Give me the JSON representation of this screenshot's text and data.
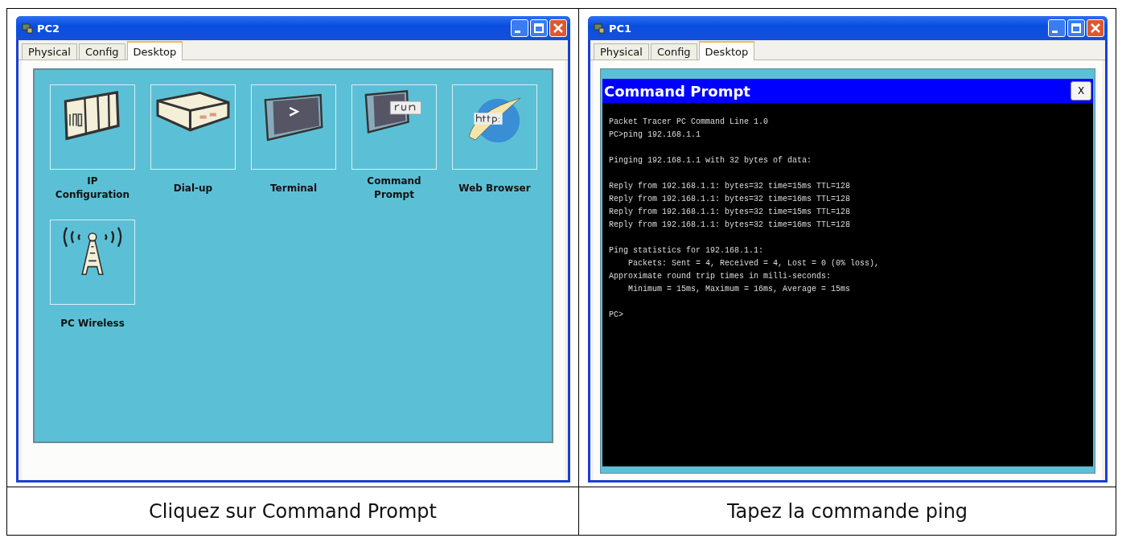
{
  "cells": [
    {
      "window": {
        "title": "PC2",
        "tabs": [
          {
            "label": "Physical",
            "selected": false
          },
          {
            "label": "Config",
            "selected": false
          },
          {
            "label": "Desktop",
            "selected": true
          }
        ],
        "view": {
          "kind": "desktop",
          "apps": [
            {
              "label": "IP Configuration"
            },
            {
              "label": "Dial-up"
            },
            {
              "label": "Terminal"
            },
            {
              "label": "Command Prompt"
            },
            {
              "label": "Web Browser"
            },
            {
              "label": "PC Wireless"
            }
          ]
        }
      },
      "caption": "Cliquez sur Command Prompt"
    },
    {
      "window": {
        "title": "PC1",
        "tabs": [
          {
            "label": "Physical",
            "selected": false
          },
          {
            "label": "Config",
            "selected": false
          },
          {
            "label": "Desktop",
            "selected": true
          }
        ],
        "view": {
          "kind": "console",
          "title": "Command Prompt",
          "close": "X",
          "blocks": [
            [
              "Packet Tracer PC Command Line 1.0",
              "PC>ping 192.168.1.1"
            ],
            [
              "Pinging 192.168.1.1 with 32 bytes of data:"
            ],
            [
              "Reply from 192.168.1.1: bytes=32 time=15ms TTL=128",
              "Reply from 192.168.1.1: bytes=32 time=16ms TTL=128",
              "Reply from 192.168.1.1: bytes=32 time=15ms TTL=128",
              "Reply from 192.168.1.1: bytes=32 time=16ms TTL=128"
            ],
            [
              "Ping statistics for 192.168.1.1:",
              "    Packets: Sent = 4, Received = 4, Lost = 0 (0% loss),",
              "Approximate round trip times in milli-seconds:",
              "    Minimum = 15ms, Maximum = 16ms, Average = 15ms"
            ],
            [
              "PC>"
            ]
          ]
        }
      },
      "caption": "Tapez la commande ping"
    }
  ]
}
